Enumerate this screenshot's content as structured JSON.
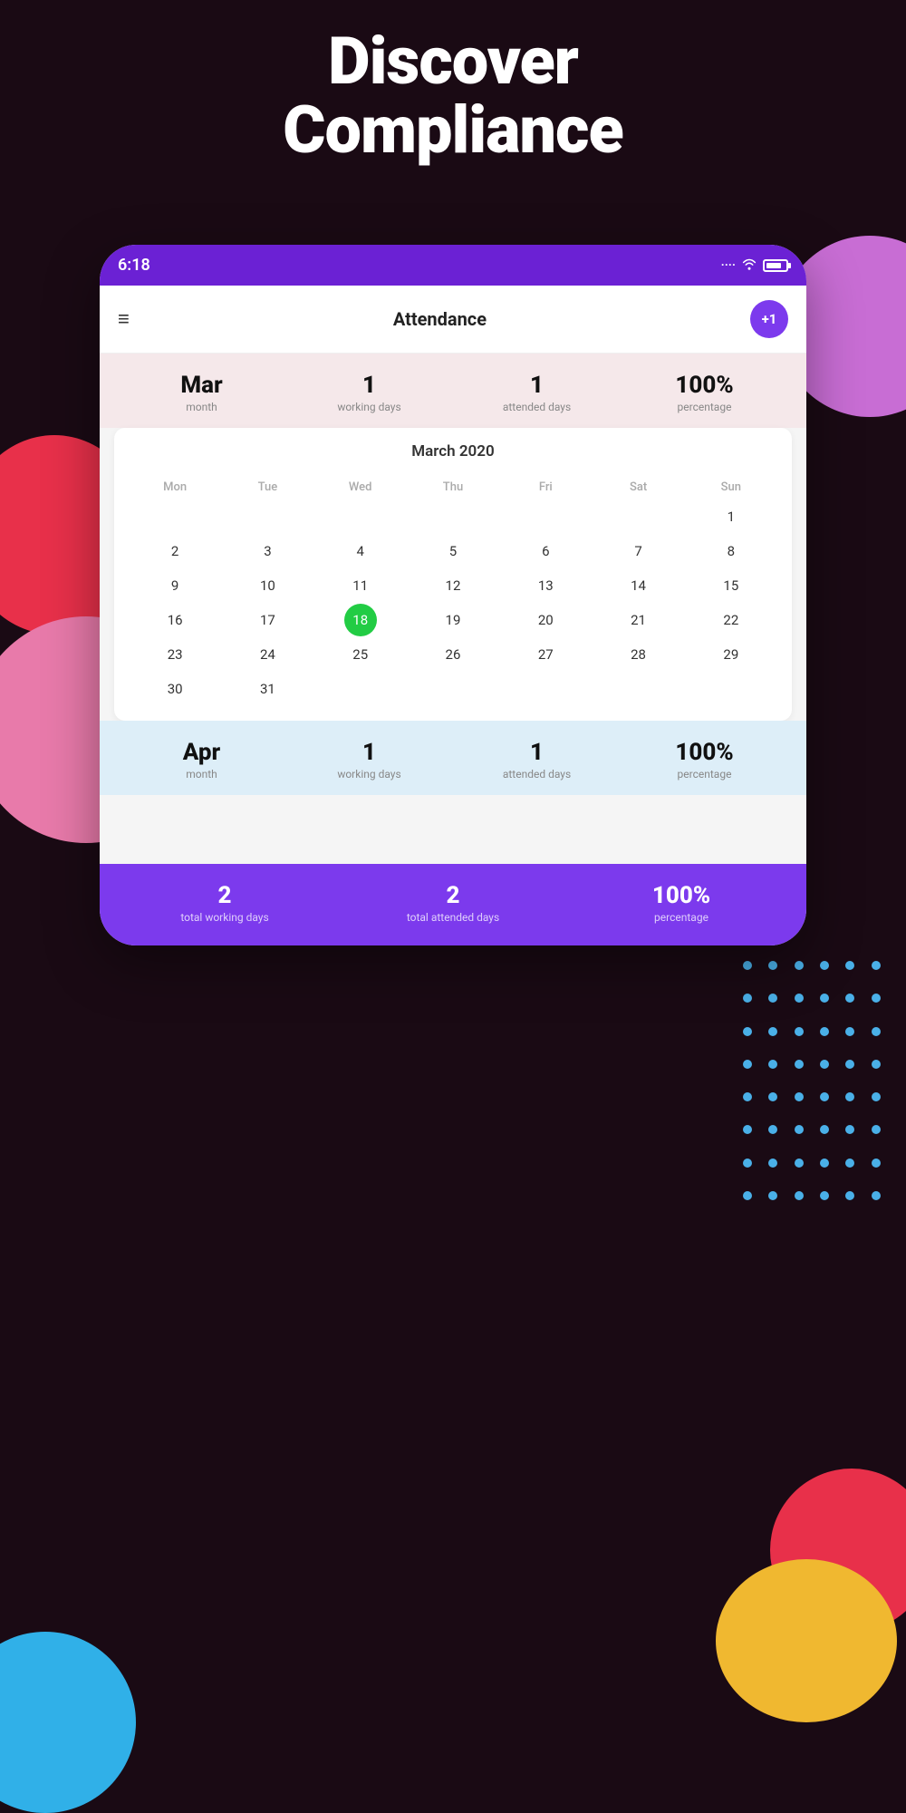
{
  "header": {
    "line1": "Discover",
    "line2": "Compliance"
  },
  "statusBar": {
    "time": "6:18",
    "dots": "····",
    "wifi": "wifi",
    "battery": "battery"
  },
  "appHeader": {
    "title": "Attendance",
    "plusBadge": "+1",
    "hamburger": "≡"
  },
  "mar": {
    "month": "Mar",
    "monthLabel": "month",
    "workingDays": "1",
    "workingDaysLabel": "working days",
    "attendedDays": "1",
    "attendedDaysLabel": "attended days",
    "percentage": "100%",
    "percentageLabel": "percentage"
  },
  "calendar": {
    "title": "March 2020",
    "dayHeaders": [
      "Mon",
      "Tue",
      "Wed",
      "Thu",
      "Fri",
      "Sat",
      "Sun"
    ],
    "rows": [
      [
        "",
        "",
        "",
        "",
        "",
        "",
        "1"
      ],
      [
        "2",
        "3",
        "4",
        "5",
        "6",
        "7",
        "8"
      ],
      [
        "9",
        "10",
        "11",
        "12",
        "13",
        "14",
        "15"
      ],
      [
        "16",
        "17",
        "18",
        "19",
        "20",
        "21",
        "22"
      ],
      [
        "23",
        "24",
        "25",
        "26",
        "27",
        "28",
        "29"
      ],
      [
        "30",
        "31",
        "",
        "",
        "",
        "",
        ""
      ]
    ],
    "todayDate": "18"
  },
  "apr": {
    "month": "Apr",
    "monthLabel": "month",
    "workingDays": "1",
    "workingDaysLabel": "working days",
    "attendedDays": "1",
    "attendedDaysLabel": "attended days",
    "percentage": "100%",
    "percentageLabel": "percentage"
  },
  "footer": {
    "totalWorkingDays": "2",
    "totalWorkingDaysLabel": "total working days",
    "totalAttendedDays": "2",
    "totalAttendedDaysLabel": "total attended days",
    "percentage": "100%",
    "percentageLabel": "percentage"
  }
}
